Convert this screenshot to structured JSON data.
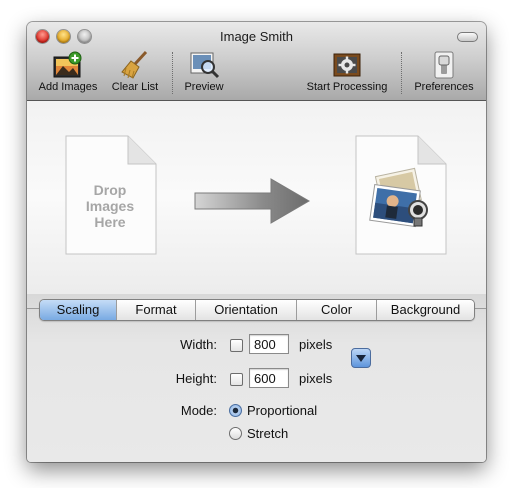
{
  "window": {
    "title": "Image Smith"
  },
  "toolbar": {
    "add_images": "Add Images",
    "clear_list": "Clear List",
    "preview": "Preview",
    "start_processing": "Start Processing",
    "preferences": "Preferences"
  },
  "drop_area": {
    "placeholder": "Drop\nImages\nHere"
  },
  "tabs": [
    {
      "label": "Scaling",
      "selected": true
    },
    {
      "label": "Format",
      "selected": false
    },
    {
      "label": "Orientation",
      "selected": false
    },
    {
      "label": "Color",
      "selected": false
    },
    {
      "label": "Background",
      "selected": false
    }
  ],
  "scaling": {
    "width_label": "Width:",
    "width_checked": false,
    "width_value": "800",
    "height_label": "Height:",
    "height_checked": false,
    "height_value": "600",
    "units": "pixels",
    "mode_label": "Mode:",
    "mode_options": [
      "Proportional",
      "Stretch"
    ],
    "mode_selected": "Proportional"
  },
  "colors": {
    "selected_tab": "#79aae3",
    "close": "#d8231b",
    "minimize": "#e0a11a"
  }
}
